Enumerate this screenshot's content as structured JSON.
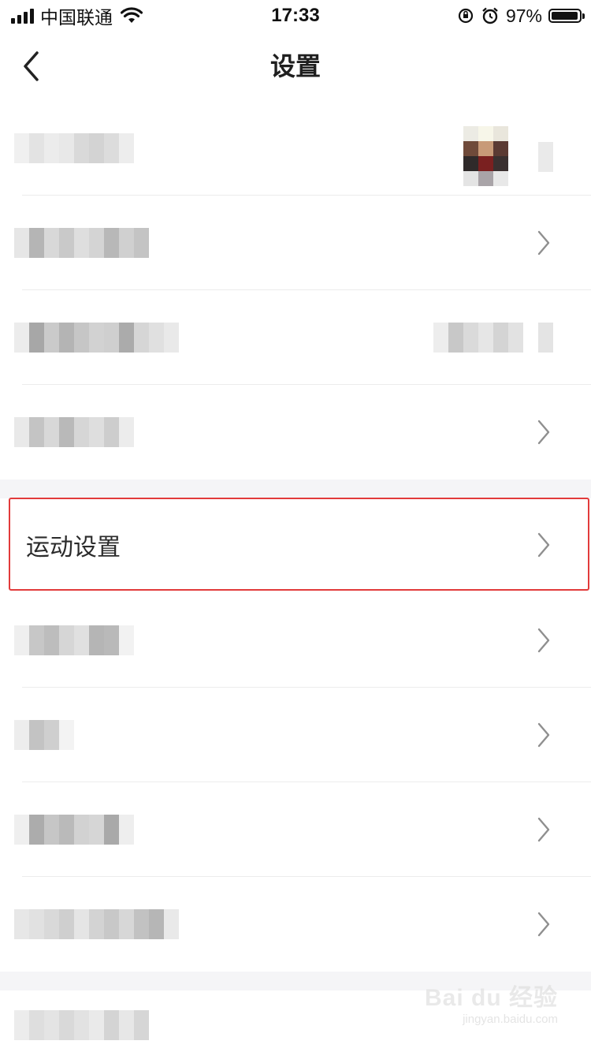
{
  "status_bar": {
    "carrier": "中国联通",
    "time": "17:33",
    "battery": "97%",
    "battery_level": 0.97
  },
  "nav": {
    "title": "设置",
    "back_icon": "chevron-left-icon"
  },
  "rows": {
    "sport_settings_label": "运动设置",
    "chevron_icon": "chevron-right-icon"
  },
  "watermark": {
    "logo": "Bai du 经验",
    "url": "jingyan.baidu.com"
  },
  "colors": {
    "highlight": "#e23b3b",
    "section_gap": "#f5f5f7",
    "divider": "#ececec"
  }
}
